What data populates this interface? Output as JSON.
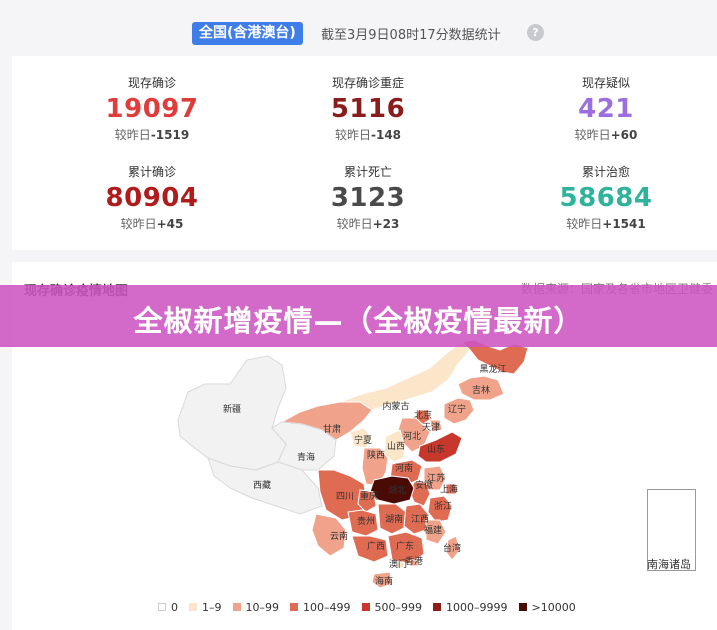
{
  "header": {
    "region_badge": "全国(含港澳台)",
    "as_of": "截至3月9日08时17分数据统计",
    "help_icon": "?"
  },
  "stats": [
    {
      "label": "现存确诊",
      "value": "19097",
      "delta_prefix": "较昨日",
      "delta": "-1519",
      "color": "#e03c3c"
    },
    {
      "label": "现存确诊重症",
      "value": "5116",
      "delta_prefix": "较昨日",
      "delta": "-148",
      "color": "#8a1c1c"
    },
    {
      "label": "现存疑似",
      "value": "421",
      "delta_prefix": "较昨日",
      "delta": "+60",
      "color": "#9b6fe0"
    },
    {
      "label": "累计确诊",
      "value": "80904",
      "delta_prefix": "较昨日",
      "delta": "+45",
      "color": "#b01c1c"
    },
    {
      "label": "累计死亡",
      "value": "3123",
      "delta_prefix": "较昨日",
      "delta": "+23",
      "color": "#4a4a4a"
    },
    {
      "label": "累计治愈",
      "value": "58684",
      "delta_prefix": "较昨日",
      "delta": "+1541",
      "color": "#2fb39a"
    }
  ],
  "map": {
    "title": "现存确诊疫情地图",
    "source": "数据来源：国家及各省市地区卫健委",
    "inset_label": "南海诸岛",
    "provinces": [
      {
        "name": "黑龙江",
        "level": 3
      },
      {
        "name": "吉林",
        "level": 2
      },
      {
        "name": "辽宁",
        "level": 2
      },
      {
        "name": "内蒙古",
        "level": 1
      },
      {
        "name": "新疆",
        "level": 0
      },
      {
        "name": "甘肃",
        "level": 2
      },
      {
        "name": "宁夏",
        "level": 1
      },
      {
        "name": "青海",
        "level": 0
      },
      {
        "name": "西藏",
        "level": 0
      },
      {
        "name": "北京",
        "level": 3
      },
      {
        "name": "天津",
        "level": 2
      },
      {
        "name": "河北",
        "level": 2
      },
      {
        "name": "山西",
        "level": 1
      },
      {
        "name": "陕西",
        "level": 2
      },
      {
        "name": "河南",
        "level": 3
      },
      {
        "name": "山东",
        "level": 4
      },
      {
        "name": "江苏",
        "level": 2
      },
      {
        "name": "安徽",
        "level": 3
      },
      {
        "name": "上海",
        "level": 3
      },
      {
        "name": "湖北",
        "level": 6
      },
      {
        "name": "四川",
        "level": 3
      },
      {
        "name": "重庆",
        "level": 3
      },
      {
        "name": "浙江",
        "level": 3
      },
      {
        "name": "湖南",
        "level": 3
      },
      {
        "name": "江西",
        "level": 3
      },
      {
        "name": "贵州",
        "level": 3
      },
      {
        "name": "福建",
        "level": 2
      },
      {
        "name": "云南",
        "level": 2
      },
      {
        "name": "广西",
        "level": 3
      },
      {
        "name": "广东",
        "level": 3
      },
      {
        "name": "台湾",
        "level": 2
      },
      {
        "name": "香港",
        "level": 2
      },
      {
        "name": "澳门",
        "level": 1
      },
      {
        "name": "海南",
        "level": 2
      }
    ]
  },
  "legend": [
    {
      "label": "0",
      "color": "#ffffff"
    },
    {
      "label": "1–9",
      "color": "#fbe6c9"
    },
    {
      "label": "10–99",
      "color": "#f0a38a"
    },
    {
      "label": "100–499",
      "color": "#e06b53"
    },
    {
      "label": "500–999",
      "color": "#c8372b"
    },
    {
      "label": "1000–9999",
      "color": "#8d1d16"
    },
    {
      "label": ">10000",
      "color": "#4a0b07"
    }
  ],
  "banner": {
    "text": "全椒新增疫情—（全椒疫情最新）"
  }
}
